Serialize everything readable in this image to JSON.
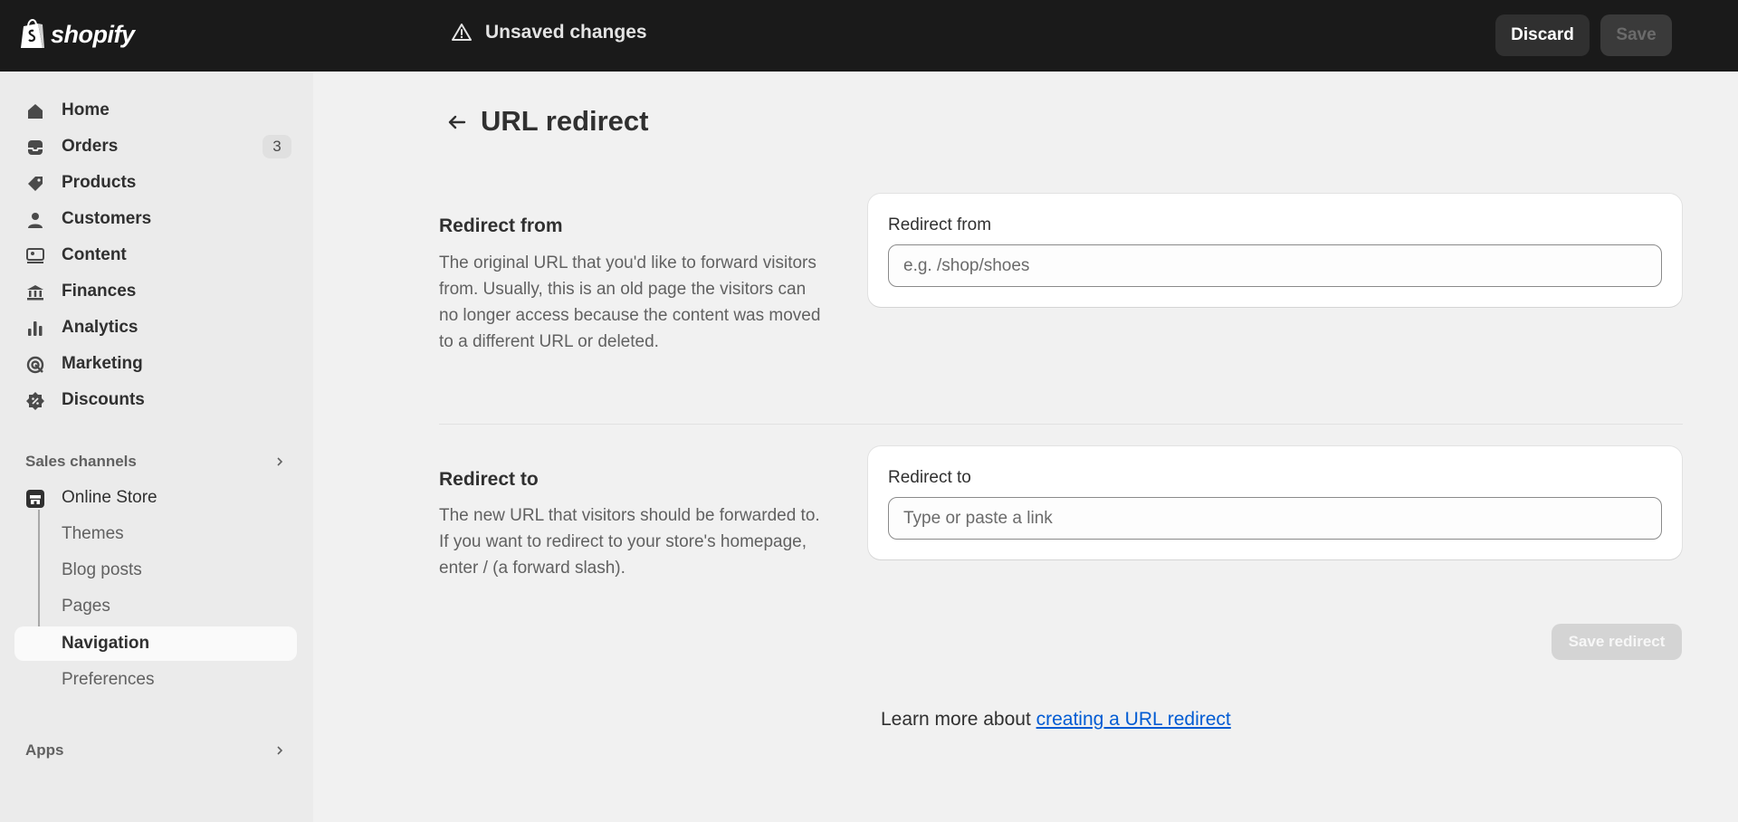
{
  "brand": {
    "logo_text": "shopify"
  },
  "topbar": {
    "unsaved_label": "Unsaved changes",
    "discard_label": "Discard",
    "save_label": "Save"
  },
  "sidebar": {
    "items": [
      {
        "label": "Home",
        "icon": "home-icon"
      },
      {
        "label": "Orders",
        "icon": "inbox-icon",
        "badge": "3"
      },
      {
        "label": "Products",
        "icon": "tag-icon"
      },
      {
        "label": "Customers",
        "icon": "person-icon"
      },
      {
        "label": "Content",
        "icon": "image-text-icon"
      },
      {
        "label": "Finances",
        "icon": "bank-icon"
      },
      {
        "label": "Analytics",
        "icon": "bar-chart-icon"
      },
      {
        "label": "Marketing",
        "icon": "target-icon"
      },
      {
        "label": "Discounts",
        "icon": "discount-icon"
      }
    ],
    "sales_channels_label": "Sales channels",
    "online_store_label": "Online Store",
    "online_store_subitems": [
      "Themes",
      "Blog posts",
      "Pages",
      "Navigation",
      "Preferences"
    ],
    "active_subitem": "Navigation",
    "apps_label": "Apps"
  },
  "page": {
    "title": "URL redirect",
    "redirect_from": {
      "section_title": "Redirect from",
      "description": "The original URL that you'd like to forward visitors from. Usually, this is an old page the visitors can no longer access because the content was moved to a different URL or deleted.",
      "field_label": "Redirect from",
      "placeholder": "e.g. /shop/shoes",
      "value": ""
    },
    "redirect_to": {
      "section_title": "Redirect to",
      "description": "The new URL that visitors should be forwarded to. If you want to redirect to your store's homepage, enter / (a forward slash).",
      "field_label": "Redirect to",
      "placeholder": "Type or paste a link",
      "value": ""
    },
    "save_redirect_label": "Save redirect",
    "learn_more_prefix": "Learn more about ",
    "learn_more_link": "creating a URL redirect"
  },
  "colors": {
    "topbar_bg": "#1a1a1a",
    "page_bg": "#f1f1f1",
    "sidebar_bg": "#ebebeb",
    "link": "#005bd3"
  }
}
